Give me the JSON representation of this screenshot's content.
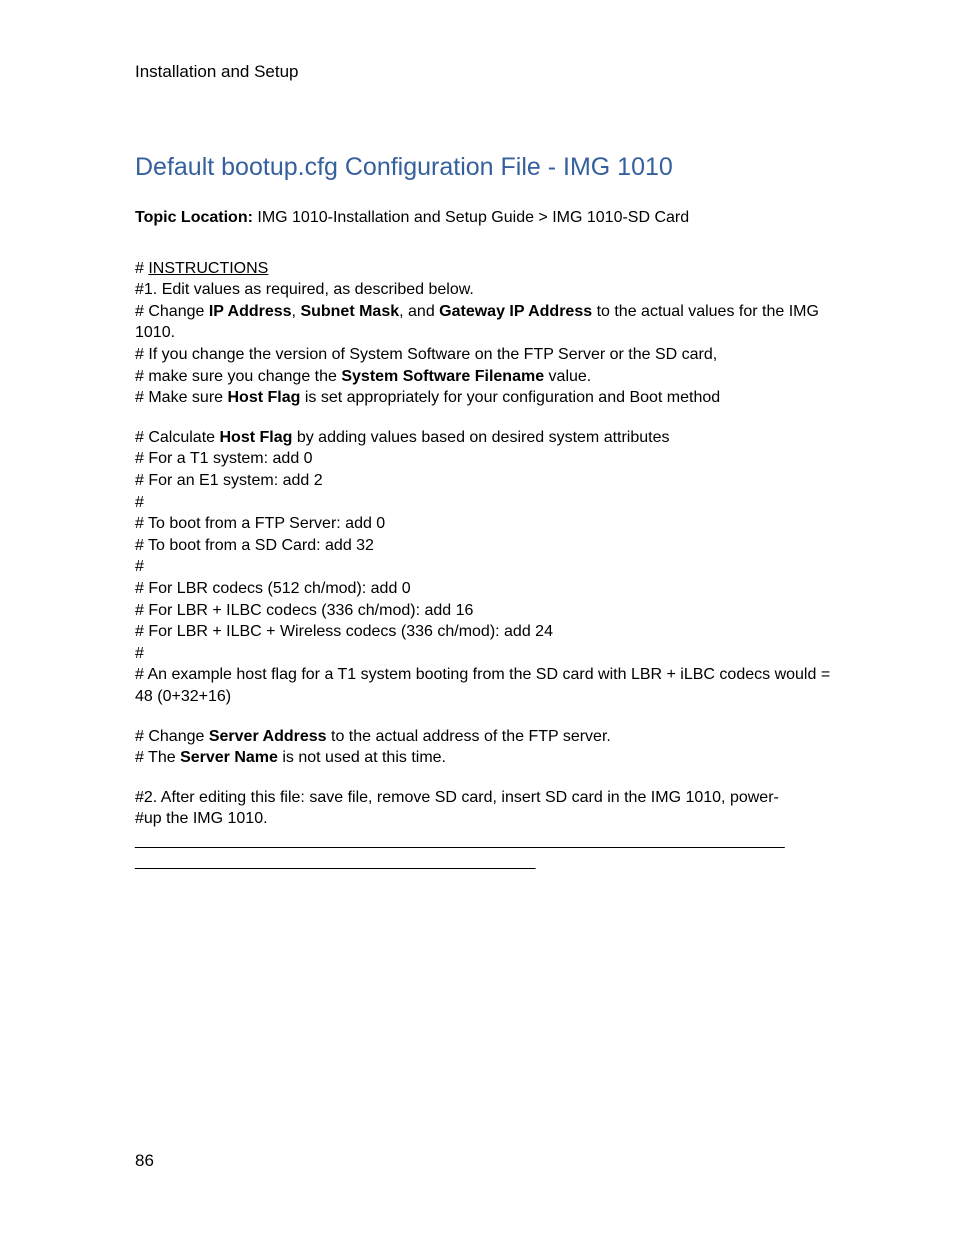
{
  "running_head": "Installation and Setup",
  "title": "Default bootup.cfg Configuration File - IMG 1010",
  "topic_location_label": "Topic Location:",
  "topic_location_value": " IMG 1010-Installation and Setup Guide > IMG 1010-SD Card",
  "instr_hash_prefix": "# ",
  "instr_label": "INSTRUCTIONS",
  "l_edit": "#1. Edit values as required, as described below.",
  "l_change_pre": "# Change ",
  "b_ip": "IP Address",
  "comma1": ", ",
  "b_subnet": "Subnet Mask",
  "mid_and": ", and ",
  "b_gateway": "Gateway IP Address",
  "l_change_post": " to the actual values for the IMG 1010.",
  "l_version": "# If you change the version of System Software on the FTP Server or the SD card,",
  "l_make_sure_pre": "# make sure you change the ",
  "b_ssfn": "System Software Filename",
  "l_make_sure_post": " value.",
  "l_host_flag_pre": "# Make sure ",
  "b_hostflag": "Host Flag",
  "l_host_flag_post": " is set appropriately for your configuration and Boot method",
  "l_calc_pre": "# Calculate ",
  "l_calc_post": " by adding values based on desired system attributes",
  "l_t1": "# For a T1 system: add 0",
  "l_e1": "# For an E1 system: add 2",
  "l_hash": "#",
  "l_ftp": "# To boot from a FTP Server: add 0",
  "l_sd": "# To boot from a SD Card: add 32",
  "l_lbr": "# For LBR codecs (512 ch/mod): add 0",
  "l_lbr_ilbc": "# For LBR + ILBC codecs (336 ch/mod): add 16",
  "l_lbr_ilbc_wireless": "# For LBR + ILBC + Wireless codecs (336 ch/mod): add 24",
  "l_example": "# An example host flag for a T1 system booting from the SD card with LBR + iLBC codecs would = 48 (0+32+16)",
  "l_server_addr_pre": "# Change ",
  "b_server_addr": "Server Address",
  "l_server_addr_post": " to the actual address of the FTP server.",
  "l_server_name_pre": "# The ",
  "b_server_name": "Server Name",
  "l_server_name_post": " is not used at this time.",
  "l_after1": "#2. After editing this file: save file, remove SD card, insert SD card in the IMG 1010, power-",
  "l_after2": "#up the IMG 1010.",
  "rule1": "_________________________________________________________________________",
  "rule2": "_____________________________________________",
  "page_number": "86"
}
